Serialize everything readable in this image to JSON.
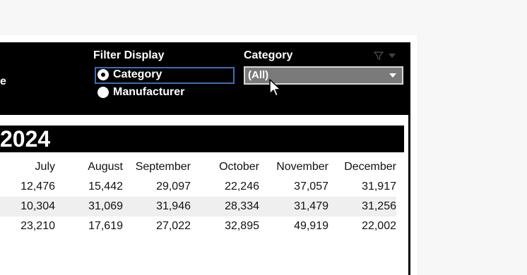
{
  "header": {
    "left_label_partial": "e",
    "filter_display": {
      "title": "Filter Display",
      "options": [
        {
          "label": "Category",
          "selected": true
        },
        {
          "label": "Manufacturer",
          "selected": false
        }
      ]
    },
    "category": {
      "title": "Category",
      "selected_value": "(All)",
      "icons": [
        "filter-icon",
        "dropdown-arrow-icon"
      ]
    }
  },
  "year_title": "2024",
  "table": {
    "columns": [
      "July",
      "August",
      "September",
      "October",
      "November",
      "December"
    ],
    "rows": [
      [
        "12,476",
        "15,442",
        "29,097",
        "22,246",
        "37,057",
        "31,917"
      ],
      [
        "10,304",
        "31,069",
        "31,946",
        "28,334",
        "31,479",
        "31,256"
      ],
      [
        "23,210",
        "17,619",
        "27,022",
        "32,895",
        "49,919",
        "22,002"
      ]
    ]
  },
  "colors": {
    "header_bg": "#000000",
    "selection_border": "#3b6fb6",
    "select_bg": "#7a7a7a",
    "alt_row": "#efefef"
  }
}
